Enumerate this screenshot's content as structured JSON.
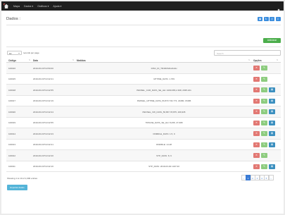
{
  "navbar": {
    "home_icon": "home-icon",
    "items": [
      {
        "label": "Mapa"
      },
      {
        "label": "Dados ▾"
      },
      {
        "label": "Gráficos ▾"
      },
      {
        "label": "Ajuda ▾"
      }
    ],
    "right_icon": "user-icon"
  },
  "page": {
    "title": "Dados :",
    "tool_icons": [
      "save-icon",
      "refresh-icon",
      "print-icon",
      "export-icon"
    ],
    "add_button": "Adicionar",
    "length": {
      "value": "10",
      "label": "records per page"
    },
    "search_placeholder": "Search"
  },
  "table": {
    "headers": [
      "Código",
      "Data",
      "Medidas",
      "Opções"
    ],
    "rows": [
      {
        "code": "100016",
        "date": "2019-06-19T13:50:00",
        "measure": "DISC_ID_TR4R4S4G4G4H"
      },
      {
        "code": "100015",
        "date": "2019-06-19T13:42:21",
        "measure": "UPTIME_DATA: 1.709"
      },
      {
        "code": "100018",
        "date": "2019-06-19T13:42:55",
        "measure": "PENSEL_CUR_DATA_SE_HH: 4490.065,2.398, 2935.221"
      },
      {
        "code": "100017",
        "date": "2019-06-19T13:42:19",
        "measure": "PENSEL_UPTIME_DATA_56,873.734.774, 22480, 15486"
      },
      {
        "code": "100020",
        "date": "2019-06-19T13:42:24",
        "measure": "PENSEL_VW_DATA_56,867.78,875, 296,935"
      },
      {
        "code": "100019",
        "date": "2019-06-19T13:42:55",
        "measure": "TRNLSE_DATA_SE_HH: 8,295, 27,998"
      },
      {
        "code": "100014",
        "date": "2019-06-19T13:42:23",
        "measure": "DNMRLE_DATA: 1.5, 9"
      },
      {
        "code": "100013",
        "date": "2019-06-19T13:42:21",
        "measure": "DNMRLE: 14.28"
      },
      {
        "code": "100012",
        "date": "2019-06-19T13:42:20",
        "measure": "STP_DATA: 8, 9"
      },
      {
        "code": "100011",
        "date": "2019-06-19T13:42:16",
        "measure": "STP_DATA: 2019-03-02 1347.00"
      }
    ]
  },
  "footer": {
    "info": "Showing 1 to 10 of 1,000 entries",
    "pages": [
      "‹",
      "1",
      "2",
      "3",
      "4",
      "5",
      "›"
    ],
    "active_page": "1",
    "export_button": "Exportar dados"
  },
  "colors": {
    "navbar": "#1f1f1f",
    "primary": "#3a7bd5",
    "success": "#4cae4c",
    "danger_light": "#e27873",
    "success_light": "#8dcc7f",
    "info": "#3b8fbf"
  }
}
